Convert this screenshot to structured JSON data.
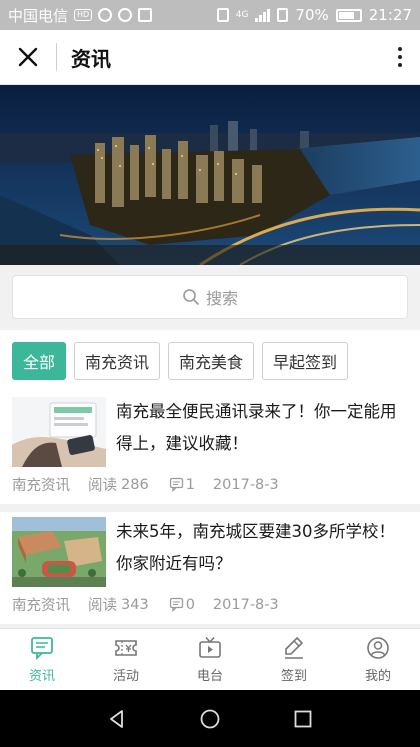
{
  "status_bar": {
    "carrier": "中国电信",
    "hd": "HD",
    "network": "4G",
    "battery": "70%",
    "time": "21:27"
  },
  "header": {
    "title": "资讯"
  },
  "search": {
    "placeholder": "搜索"
  },
  "tabs": [
    {
      "label": "全部",
      "active": true
    },
    {
      "label": "南充资讯",
      "active": false
    },
    {
      "label": "南充美食",
      "active": false
    },
    {
      "label": "早起签到",
      "active": false
    }
  ],
  "articles": [
    {
      "title": "南充最全便民通讯录来了！你一定能用得上，建议收藏！",
      "source": "南充资讯",
      "read_label": "阅读",
      "reads": "286",
      "comments": "1",
      "date": "2017-8-3"
    },
    {
      "title": "未来5年，南充城区要建30多所学校！你家附近有吗？",
      "source": "南充资讯",
      "read_label": "阅读",
      "reads": "343",
      "comments": "0",
      "date": "2017-8-3"
    }
  ],
  "bottom_nav": [
    {
      "label": "资讯",
      "icon": "news-icon",
      "active": true
    },
    {
      "label": "活动",
      "icon": "ticket-icon",
      "active": false
    },
    {
      "label": "电台",
      "icon": "radio-icon",
      "active": false
    },
    {
      "label": "签到",
      "icon": "sign-in-icon",
      "active": false
    },
    {
      "label": "我的",
      "icon": "profile-icon",
      "active": false
    }
  ],
  "colors": {
    "accent": "#3cb79a",
    "status_bar": "#bdbdbd"
  }
}
